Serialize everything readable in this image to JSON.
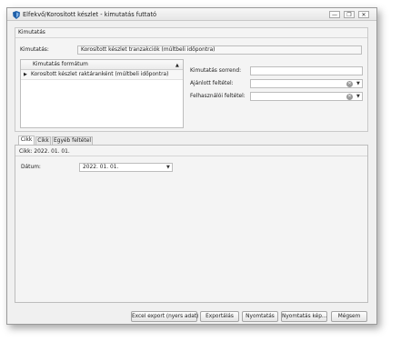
{
  "window": {
    "title": "Elfekvő/Korosított készlet - kimutatás futtató",
    "minimize_label": "—",
    "restore_label": "❐",
    "close_label": "✕"
  },
  "group": {
    "title": "Kimutatás",
    "report_label": "Kimutatás:",
    "report_value": "Korosított készlet tranzakciók (múltbeli időpontra)"
  },
  "formats": {
    "column_header": "Kimutatás formátum",
    "rows": [
      "Korosított készlet raktáranként (múltbeli időpontra)"
    ]
  },
  "options": {
    "order_label": "Kimutatás sorrend:",
    "order_value": "",
    "recommended_label": "Ajánlott feltétel:",
    "recommended_value": "",
    "user_label": "Felhasználói feltétel:",
    "user_value": ""
  },
  "tabs": [
    {
      "label": "Cikk",
      "active": true
    },
    {
      "label": "Cikk",
      "active": false
    },
    {
      "label": "Egyéb feltétel",
      "active": false
    }
  ],
  "tab_content": {
    "info": "Cikk: 2022. 01. 01.",
    "date_label": "Dátum:",
    "date_value": "2022. 01. 01."
  },
  "buttons": {
    "excel": "Excel export (nyers adat)",
    "export": "Exportálás",
    "print": "Nyomtatás",
    "print_image": "Nyomtatás kép...",
    "cancel": "Mégsem"
  },
  "icons": {
    "app": "shield-icon",
    "clear": "clear-circle-icon",
    "dropdown": "chevron-down-icon",
    "sort": "sort-up-icon",
    "row_pointer": "row-pointer-icon"
  },
  "colors": {
    "app_icon": "#1f5fa8",
    "window_bg": "#f0f0f0",
    "border": "#bdbdbd"
  }
}
